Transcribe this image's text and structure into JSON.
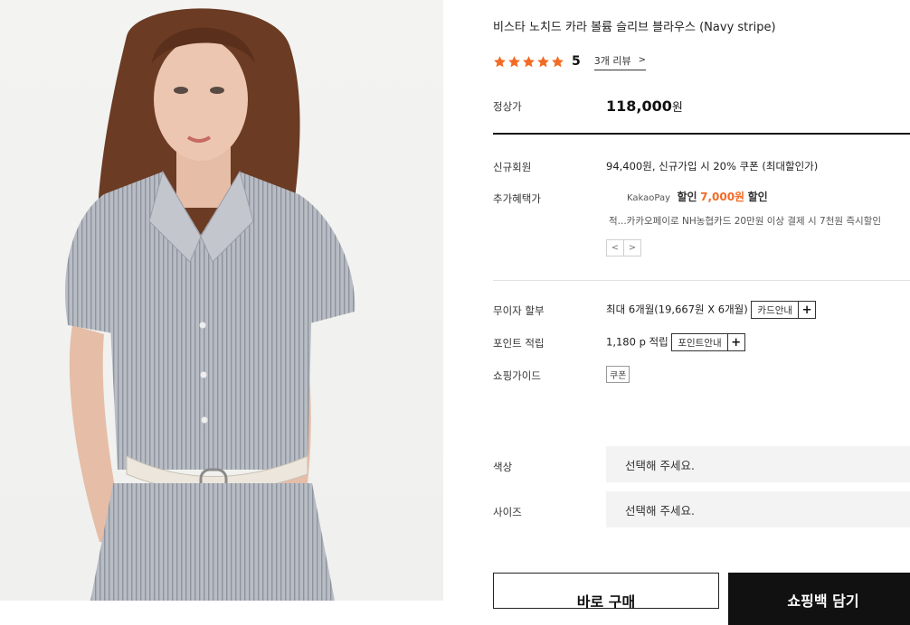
{
  "product": {
    "title": "비스타 노치드 카라 볼륨 슬리브 블라우스 (Navy stripe)",
    "rating_score": "5",
    "star_color": "#f26b25",
    "review_link": "3개 리뷰",
    "review_chevron": ">"
  },
  "pricing": {
    "regular_label": "정상가",
    "regular_price": "118,000",
    "regular_unit": "원",
    "member_label": "신규회원",
    "member_text": "94,400원, 신규가입 시 20% 쿠폰 (최대할인가)",
    "extra_label": "추가혜택가",
    "kakao_brand": "KakaoPay",
    "kakao_discount_word": "할인",
    "kakao_amount": "7,000원",
    "kakao_discount_word2": "할인",
    "kakao_desc": "적...카카오페이로 NH농협카드 20만원 이상 결제 시 7천원 즉시할인",
    "pager_prev": "<",
    "pager_next": ">"
  },
  "benefits": {
    "installment_label": "무이자 할부",
    "installment_text": "최대 6개월(19,667원 X 6개월)",
    "installment_btn": "카드안내",
    "points_label": "포인트 적립",
    "points_text": "1,180 p 적립",
    "points_btn": "포인트안내",
    "plus": "+",
    "guide_label": "쇼핑가이드",
    "guide_tag": "쿠폰"
  },
  "options": {
    "color_label": "색상",
    "color_placeholder": "선택해 주세요.",
    "size_label": "사이즈",
    "size_placeholder": "선택해 주세요."
  },
  "actions": {
    "buy_now": "바로 구매",
    "add_to_cart": "쇼핑백 담기"
  }
}
